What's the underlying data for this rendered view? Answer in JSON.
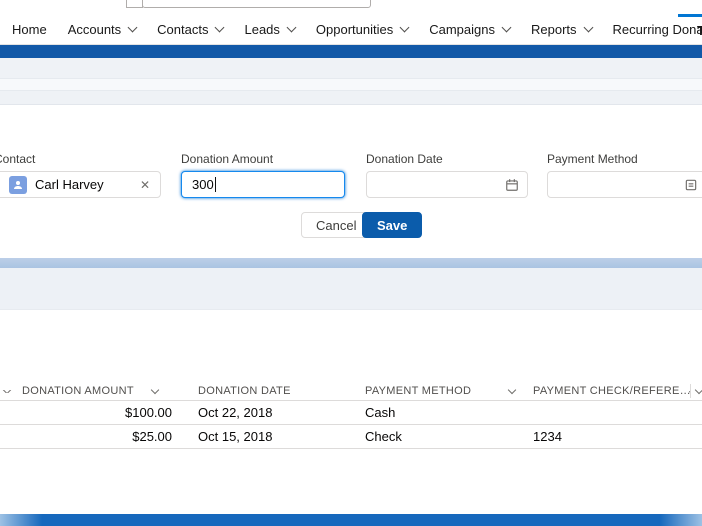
{
  "nav": {
    "tabs": [
      {
        "label": "Home"
      },
      {
        "label": "Accounts"
      },
      {
        "label": "Contacts"
      },
      {
        "label": "Leads"
      },
      {
        "label": "Opportunities"
      },
      {
        "label": "Campaigns"
      },
      {
        "label": "Reports"
      },
      {
        "label": "Recurring Donations"
      }
    ],
    "clipped_tab_label": "T"
  },
  "form": {
    "contact": {
      "label": "Contact",
      "value": "Carl Harvey"
    },
    "donation_amount": {
      "label": "Donation Amount",
      "value": "300"
    },
    "donation_date": {
      "label": "Donation Date",
      "value": ""
    },
    "payment_method": {
      "label": "Payment Method",
      "value": ""
    },
    "buttons": {
      "cancel": "Cancel",
      "save": "Save"
    }
  },
  "table": {
    "columns": [
      {
        "label": "DONATION AMOUNT"
      },
      {
        "label": "DONATION DATE"
      },
      {
        "label": "PAYMENT METHOD"
      },
      {
        "label": "PAYMENT CHECK/REFERE…"
      }
    ],
    "rows": [
      {
        "donation_amount": "$100.00",
        "donation_date": "Oct 22, 2018",
        "payment_method": "Cash",
        "payment_check_reference": ""
      },
      {
        "donation_amount": "$25.00",
        "donation_date": "Oct 15, 2018",
        "payment_method": "Check",
        "payment_check_reference": "1234"
      }
    ]
  },
  "colors": {
    "brand_blue": "#0176d3",
    "header_bar": "#1259a8",
    "save_button": "#0b5cab",
    "focus_border": "#1589ee",
    "contact_icon": "#7b9fe0",
    "band_blue": "#aac4e2"
  }
}
